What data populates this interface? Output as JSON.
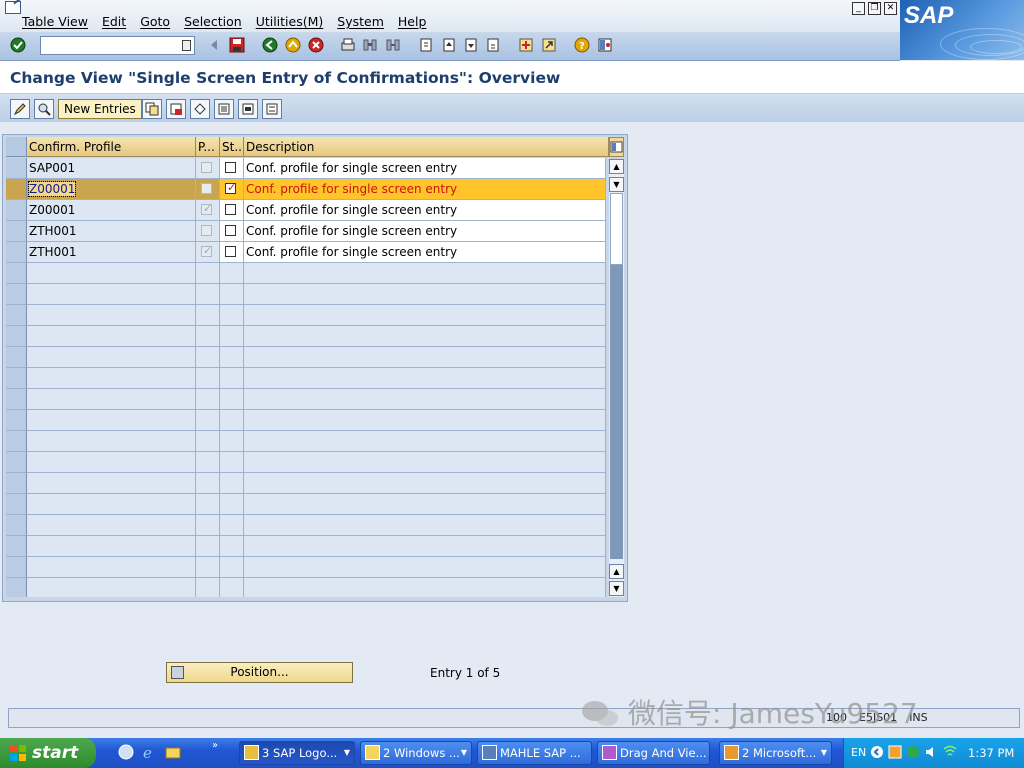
{
  "menubar": {
    "items": [
      "Table View",
      "Edit",
      "Goto",
      "Selection",
      "Utilities(M)",
      "System",
      "Help"
    ]
  },
  "brand": {
    "logo_text": "SAP"
  },
  "toolbar": {
    "command_field_value": "",
    "icons": [
      "enter-icon",
      "back-icon",
      "save-icon",
      "green-back-icon",
      "exit-icon",
      "cancel-icon",
      "print-icon",
      "find-icon",
      "find-next-icon",
      "first-page-icon",
      "prev-page-icon",
      "next-page-icon",
      "last-page-icon",
      "new-session-icon",
      "shortcut-icon",
      "help-icon",
      "layout-icon"
    ]
  },
  "title": "Change View \"Single Screen Entry of Confirmations\": Overview",
  "app_toolbar": {
    "new_entries_label": "New Entries",
    "icons": [
      "edit-toggle-icon",
      "details-icon",
      "copy-as-icon",
      "delete-icon",
      "undo-icon",
      "select-all-icon",
      "select-block-icon",
      "deselect-all-icon"
    ]
  },
  "table": {
    "headers": [
      "Confirm. Profile",
      "P...",
      "St...",
      "Description"
    ],
    "rows": [
      {
        "profile": "SAP001",
        "p": false,
        "st": false,
        "desc": "Conf. profile for single screen entry",
        "selected": false
      },
      {
        "profile": "Z00001",
        "p": false,
        "st": true,
        "desc": "Conf. profile for single screen entry",
        "selected": true
      },
      {
        "profile": "Z00001",
        "p": true,
        "st": false,
        "desc": "Conf. profile for single screen entry",
        "selected": false
      },
      {
        "profile": "ZTH001",
        "p": false,
        "st": false,
        "desc": "Conf. profile for single screen entry",
        "selected": false
      },
      {
        "profile": "ZTH001",
        "p": true,
        "st": false,
        "desc": "Conf. profile for single screen entry",
        "selected": false
      }
    ],
    "empty_rows": 16
  },
  "position_button": {
    "label": "Position..."
  },
  "entry_info": "Entry 1 of 5",
  "status": {
    "client": "100",
    "server": "E5JS01",
    "mode": "INS"
  },
  "watermark": "微信号: JamesYu9527",
  "taskbar": {
    "start_label": "start",
    "tasks": [
      {
        "label": "3 SAP Logo...",
        "active": true,
        "has_arrow": true
      },
      {
        "label": "2 Windows ...",
        "active": false,
        "has_arrow": true
      },
      {
        "label": "MAHLE SAP ...",
        "active": false,
        "has_arrow": false
      },
      {
        "label": "Drag And Vie...",
        "active": false,
        "has_arrow": false
      },
      {
        "label": "2 Microsoft...",
        "active": false,
        "has_arrow": true
      }
    ],
    "language": "EN",
    "clock": "1:37 PM"
  },
  "colors": {
    "selected_row": "#ffc52a",
    "header_gold": "#e6c880",
    "title_blue": "#1e3e6e",
    "taskbar_blue": "#2157d3"
  }
}
